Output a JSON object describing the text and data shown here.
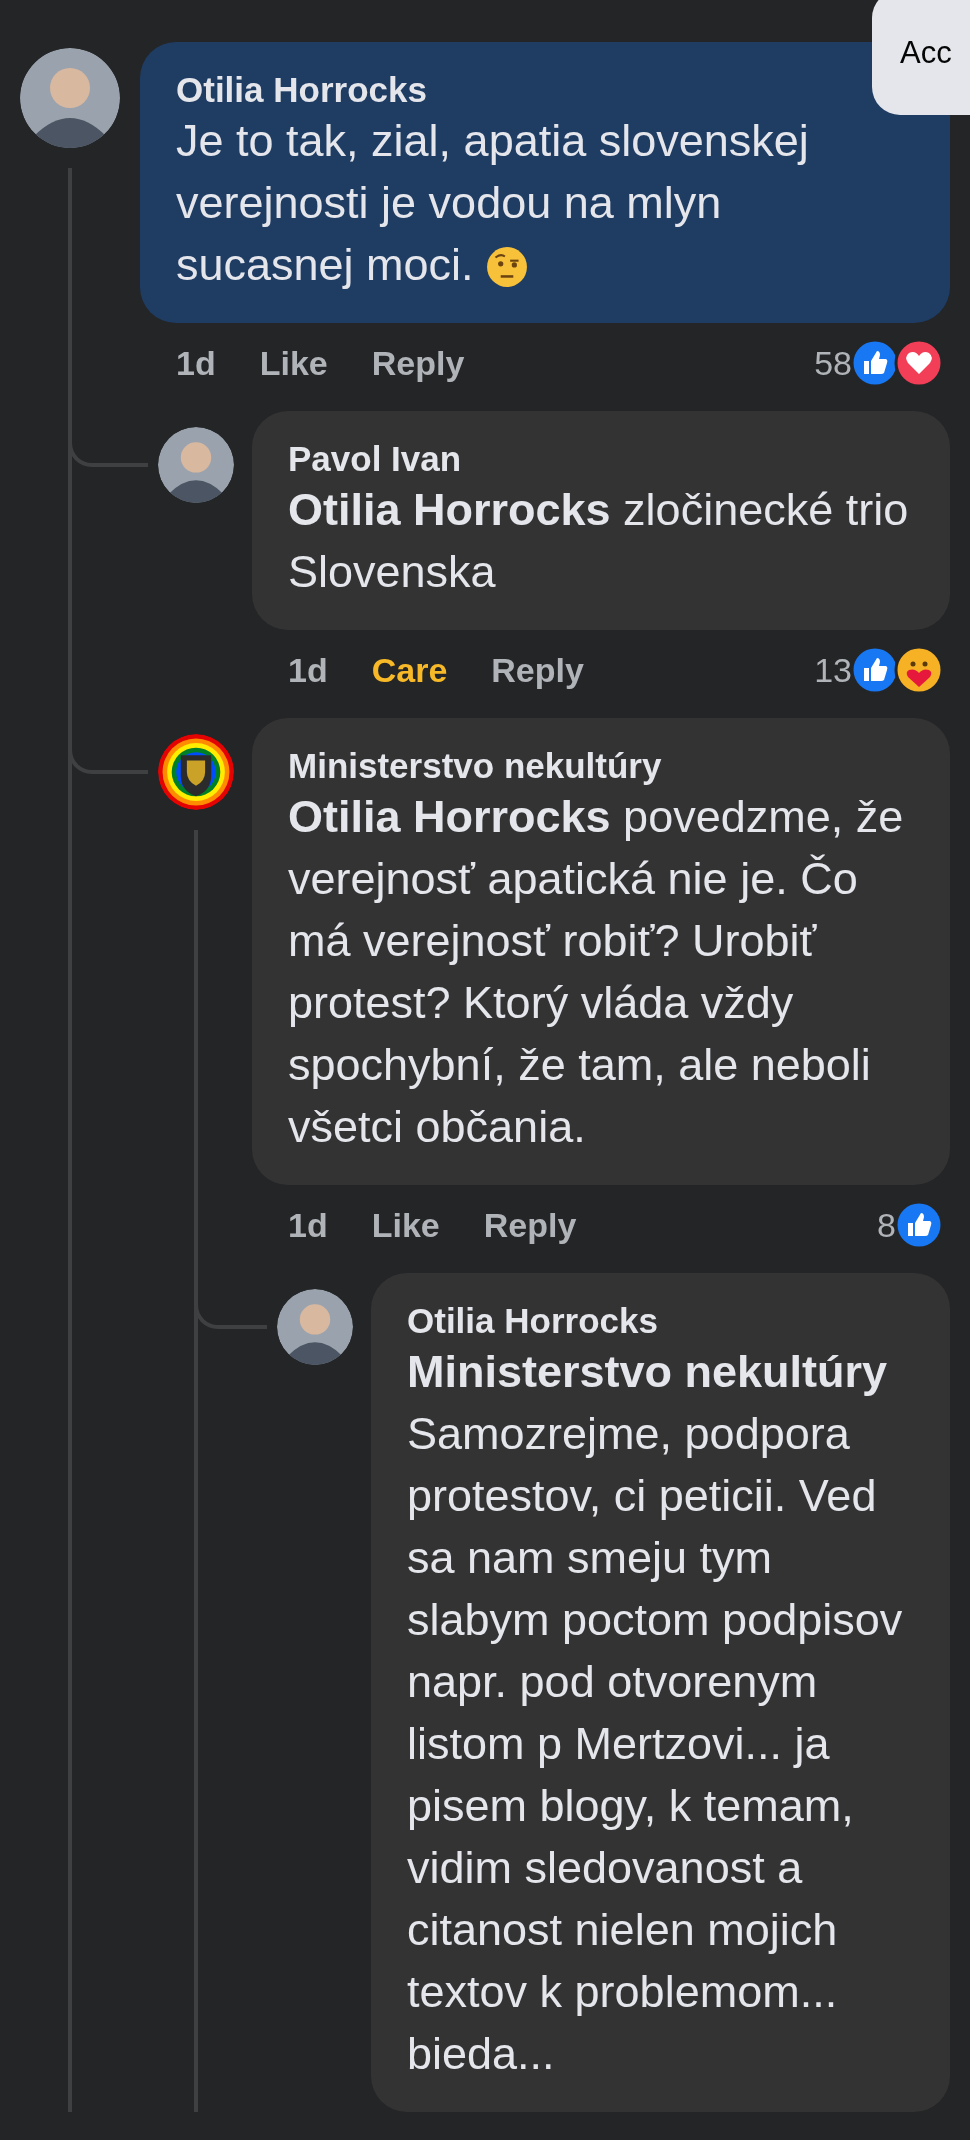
{
  "top_button": {
    "label": "Acc"
  },
  "comments": [
    {
      "author": "Otilia Horrocks",
      "avatar": {
        "kind": "photo"
      },
      "highlighted": true,
      "text": "Je to tak, zial, apatia slovenskej verejnosti je vodou na mlyn sucasnej moci.",
      "emoji": {
        "kind": "raised_eyebrow"
      },
      "time": "1d",
      "react": {
        "label": "Like",
        "reacted": false
      },
      "reply": "Reply",
      "reaction_count": "58",
      "reactions": [
        {
          "kind": "like"
        },
        {
          "kind": "love"
        }
      ],
      "children": [
        {
          "author": "Pavol Ivan",
          "avatar": {
            "kind": "photo"
          },
          "highlighted": false,
          "text": "**Otilia Horrocks** zločinecké trio Slovenska",
          "time": "1d",
          "react": {
            "label": "Care",
            "reacted": true
          },
          "reply": "Reply",
          "reaction_count": "13",
          "reactions": [
            {
              "kind": "like"
            },
            {
              "kind": "care"
            }
          ]
        },
        {
          "author": "Ministerstvo nekultúry",
          "avatar": {
            "kind": "crest"
          },
          "highlighted": false,
          "text": "**Otilia Horrocks** povedzme, že verejnosť apatická nie je. Čo má verejnosť robiť? Urobiť protest? Ktorý vláda vždy spochybní, že tam, ale neboli všetci občania.",
          "time": "1d",
          "react": {
            "label": "Like",
            "reacted": false
          },
          "reply": "Reply",
          "reaction_count": "8",
          "reactions": [
            {
              "kind": "like"
            }
          ],
          "children": [
            {
              "author": "Otilia Horrocks",
              "avatar": {
                "kind": "photo"
              },
              "highlighted": false,
              "text": "**Ministerstvo nekultúry** Samozrejme, podpora protestov, ci peticii. Ved sa nam smeju tym slabym poctom podpisov napr. pod otvorenym listom p Mertzovi... ja pisem blogy, k temam, vidim sledovanost a citanost nielen mojich textov k problemom... bieda..."
            }
          ]
        }
      ]
    }
  ]
}
